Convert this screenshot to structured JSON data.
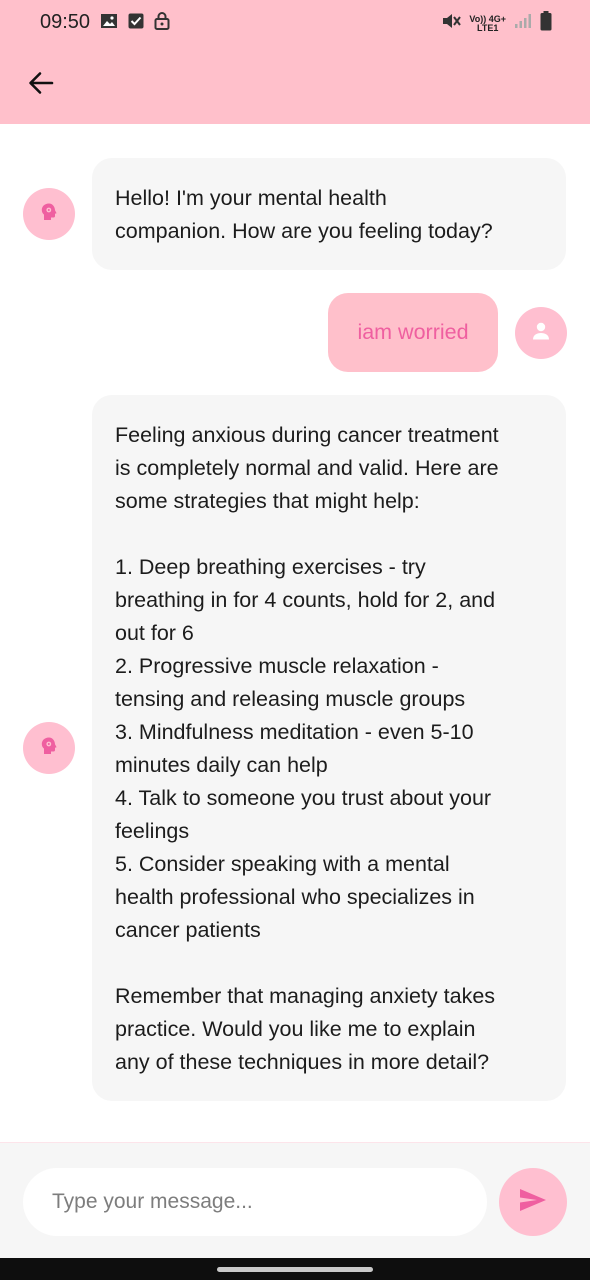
{
  "status_bar": {
    "time": "09:50",
    "network_top": "Vo)) 4G+",
    "network_bottom": "LTE1"
  },
  "header": {
    "back_icon": "arrow-left-icon"
  },
  "messages": [
    {
      "role": "bot",
      "icon": "brain-head-icon",
      "text": "Hello! I'm your mental health\ncompanion. How are you feeling today?"
    },
    {
      "role": "user",
      "icon": "person-icon",
      "text": "iam worried"
    },
    {
      "role": "bot",
      "icon": "brain-head-icon",
      "text": "Feeling anxious during cancer treatment\nis completely normal and valid. Here are\nsome strategies that might help:\n\n1. Deep breathing exercises - try\nbreathing in for 4 counts, hold for 2, and\nout for 6\n2. Progressive muscle relaxation -\ntensing and releasing muscle groups\n3. Mindfulness meditation - even 5-10\nminutes daily can help\n4. Talk to someone you trust about your\nfeelings\n5. Consider speaking with a mental\nhealth professional who specializes in\ncancer patients\n\nRemember that managing anxiety takes\npractice. Would you like me to explain\nany of these techniques in more detail?"
    }
  ],
  "composer": {
    "placeholder": "Type your message...",
    "send_icon": "send-icon"
  },
  "colors": {
    "header_bg": "#ffc0cb",
    "accent": "#ef5fa0",
    "avatar_bg": "#ffbfd0",
    "bot_bubble_bg": "#f6f6f6"
  }
}
